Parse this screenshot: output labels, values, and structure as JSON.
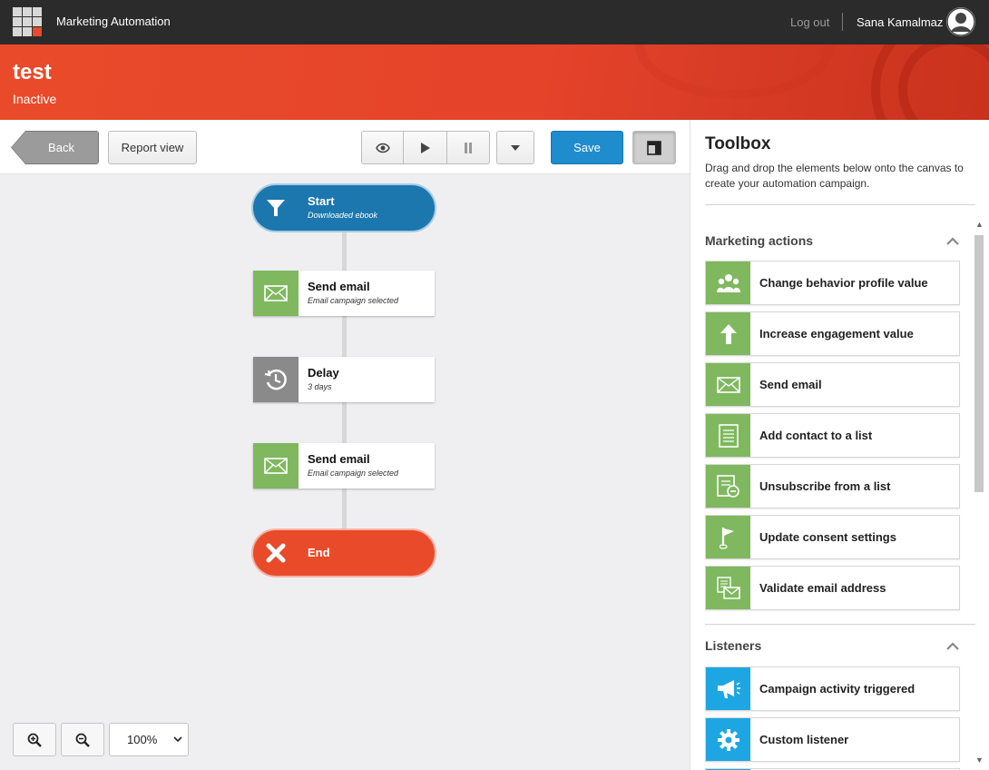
{
  "topbar": {
    "app_title": "Marketing Automation",
    "logout_label": "Log out",
    "username": "Sana Kamalmaz"
  },
  "header": {
    "title": "test",
    "status": "Inactive"
  },
  "toolbar": {
    "back_label": "Back",
    "report_view_label": "Report view",
    "save_label": "Save"
  },
  "flow": {
    "nodes": [
      {
        "name": "Start",
        "sub": "Downloaded ebook",
        "icon": "funnel-icon"
      },
      {
        "name": "Send email",
        "sub": "Email campaign selected",
        "icon": "envelope-icon"
      },
      {
        "name": "Delay",
        "sub": "3 days",
        "icon": "clock-icon"
      },
      {
        "name": "Send email",
        "sub": "Email campaign selected",
        "icon": "envelope-icon"
      },
      {
        "name": "End",
        "icon": "close-icon"
      }
    ]
  },
  "zoom": {
    "value": "100%"
  },
  "toolbox": {
    "title": "Toolbox",
    "description": "Drag and drop the elements below onto the canvas to create your automation campaign.",
    "sections": [
      {
        "title": "Marketing actions",
        "items": [
          {
            "label": "Change behavior profile value",
            "icon": "people-icon"
          },
          {
            "label": "Increase engagement value",
            "icon": "arrow-up-icon"
          },
          {
            "label": "Send email",
            "icon": "envelope-icon"
          },
          {
            "label": "Add contact to a list",
            "icon": "list-icon"
          },
          {
            "label": "Unsubscribe from a list",
            "icon": "list-remove-icon"
          },
          {
            "label": "Update consent settings",
            "icon": "flag-icon"
          },
          {
            "label": "Validate email address",
            "icon": "email-check-icon"
          }
        ]
      },
      {
        "title": "Listeners",
        "items": [
          {
            "label": "Campaign activity triggered",
            "icon": "megaphone-icon"
          },
          {
            "label": "Custom listener",
            "icon": "gear-icon"
          }
        ]
      }
    ]
  },
  "colors": {
    "topbar": "#2b2b2b",
    "header_red": "#e94b2a",
    "start_blue": "#1b77ae",
    "action_green": "#7fb85f",
    "listener_blue": "#1ea6e2",
    "save_blue": "#1f8ccd"
  }
}
